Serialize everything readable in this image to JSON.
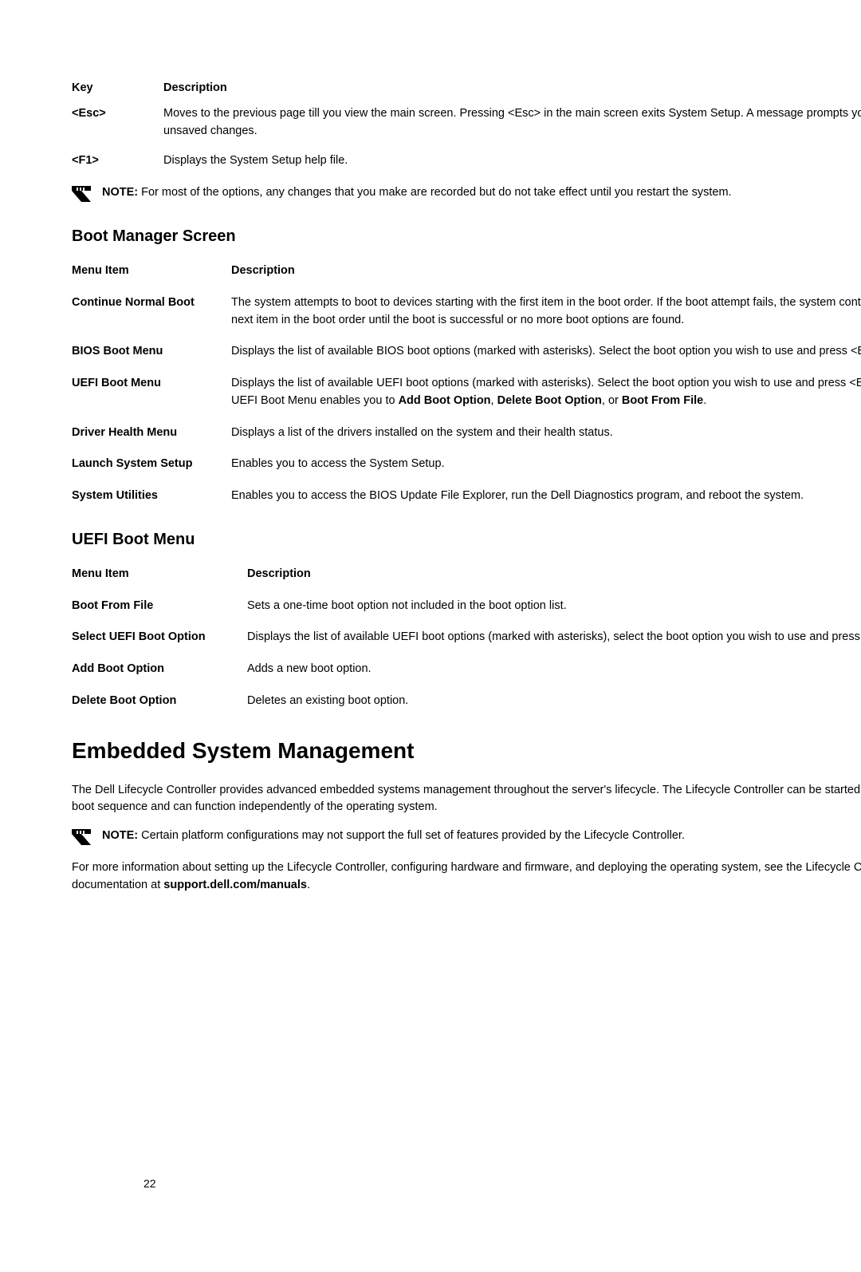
{
  "keyTableHeaders": {
    "key": "Key",
    "desc": "Description"
  },
  "keyRows": [
    {
      "key": "<Esc>",
      "desc": "Moves to the previous page till you view the main screen. Pressing <Esc> in the main screen exits System Setup. A message prompts you to save any unsaved changes."
    },
    {
      "key": "<F1>",
      "desc": "Displays the System Setup help file."
    }
  ],
  "note1": {
    "label": "NOTE:",
    "text": " For most of the options, any changes that you make are recorded but do not take effect until you restart the system."
  },
  "bootMgrTitle": "Boot Manager Screen",
  "menuHeaders": {
    "item": "Menu Item",
    "desc": "Description"
  },
  "bootMgrRows": [
    {
      "item": "Continue Normal Boot",
      "desc": "The system attempts to boot to devices starting with the first item in the boot order. If the boot attempt fails, the system continues with the next item in the boot order until the boot is successful or no more boot options are found."
    },
    {
      "item": "BIOS Boot Menu",
      "desc": "Displays the list of available BIOS boot options (marked with asterisks). Select the boot option you wish to use and press <Enter>."
    },
    {
      "item": "UEFI Boot Menu",
      "pre": "Displays the list of available UEFI boot options (marked with asterisks). Select the boot option you wish to use and press <Enter>. The UEFI Boot Menu enables you to ",
      "b1": "Add Boot Option",
      "mid1": ", ",
      "b2": "Delete Boot Option",
      "mid2": ", or ",
      "b3": "Boot From File",
      "end": "."
    },
    {
      "item": "Driver Health Menu",
      "desc": "Displays a list of the drivers installed on the system and their health status."
    },
    {
      "item": "Launch System Setup",
      "desc": "Enables you to access the System Setup."
    },
    {
      "item": "System Utilities",
      "desc": "Enables you to access the BIOS Update File Explorer, run the Dell Diagnostics program, and reboot the system."
    }
  ],
  "uefiTitle": "UEFI Boot Menu",
  "uefiRows": [
    {
      "item": "Boot From File",
      "desc": "Sets a one-time boot option not included in the boot option list."
    },
    {
      "item": "Select UEFI Boot Option",
      "desc": "Displays the list of available UEFI boot options (marked with asterisks), select the boot option you wish to use and press <Enter>."
    },
    {
      "item": "Add Boot Option",
      "desc": "Adds a new boot option."
    },
    {
      "item": "Delete Boot Option",
      "desc": "Deletes an existing boot option."
    }
  ],
  "h1": "Embedded System Management",
  "para1": "The Dell Lifecycle Controller provides advanced embedded systems management throughout the server's lifecycle. The Lifecycle Controller can be started during the boot sequence and can function independently of the operating system.",
  "note2": {
    "label": "NOTE:",
    "text": " Certain platform configurations may not support the full set of features provided by the Lifecycle Controller."
  },
  "para2": {
    "pre": "For more information about setting up the Lifecycle Controller, configuring hardware and firmware, and deploying the operating system, see the Lifecycle Controller documentation at ",
    "bold": "support.dell.com/manuals",
    "end": "."
  },
  "pageNum": "22"
}
